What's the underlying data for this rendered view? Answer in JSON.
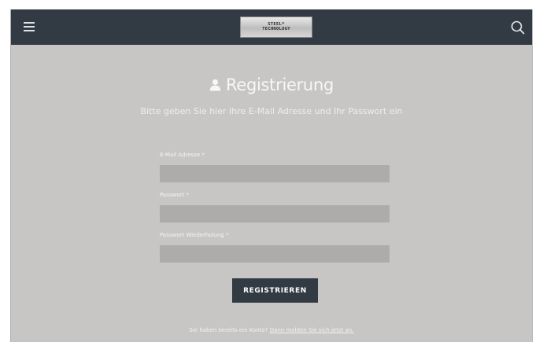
{
  "header": {
    "menu_icon": "hamburger-menu-icon",
    "logo_line1": "STEEL*",
    "logo_line2": "TECHNOLOGY",
    "search_icon": "search-icon",
    "background_color": "#323b43"
  },
  "page": {
    "title": "Registrierung",
    "title_icon": "user-icon",
    "subtitle": "Bitte geben Sie hier Ihre E-Mail Adresse und Ihr Passwort ein",
    "background_color": "#c8c6c5"
  },
  "form": {
    "email_label": "E-Mail Adresse *",
    "email_value": "",
    "password_label": "Passwort *",
    "password_value": "",
    "password_repeat_label": "Passwort Wiederholung *",
    "password_repeat_value": "",
    "submit_label": "REGISTRIEREN"
  },
  "footer": {
    "prompt": "Sie haben bereits ein Konto?",
    "login_link": "Dann melden Sie sich jetzt an."
  }
}
